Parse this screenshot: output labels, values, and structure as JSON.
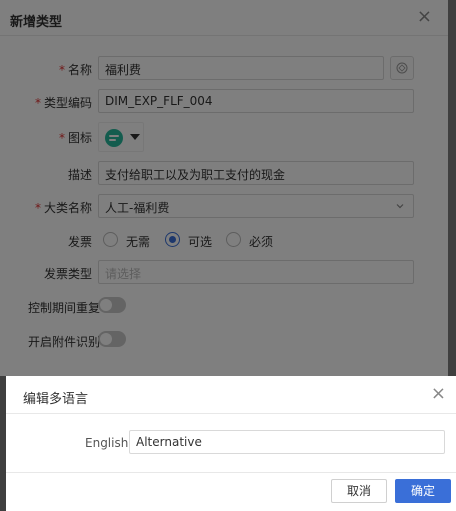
{
  "main_dialog": {
    "title": "新增类型",
    "close_glyph": "×",
    "fields": {
      "name": {
        "label": "名称",
        "value": "福利费"
      },
      "code": {
        "label": "类型编码",
        "value": "DIM_EXP_FLF_004"
      },
      "icon": {
        "label": "图标",
        "icon": "chat-bubble-icon"
      },
      "desc": {
        "label": "描述",
        "value": "支付给职工以及为职工支付的现金"
      },
      "category": {
        "label": "大类名称",
        "value": "人工-福利费"
      },
      "invoice": {
        "label": "发票",
        "options": [
          "无需",
          "可选",
          "必须"
        ],
        "selected": "可选"
      },
      "invoice_type": {
        "label": "发票类型",
        "placeholder": "请选择"
      },
      "dup_check": {
        "label": "控制期间重复",
        "on": false
      },
      "attach_ocr": {
        "label": "开启附件识别",
        "on": false
      }
    },
    "required_mark": "*"
  },
  "lang_dialog": {
    "title": "编辑多语言",
    "close_glyph": "×",
    "field_label": "English",
    "field_value": "Alternative",
    "cancel_label": "取消",
    "ok_label": "确定"
  },
  "colors": {
    "primary": "#3a6fd8",
    "required": "#e03030",
    "icon_badge": "#27b89c",
    "overlay": "rgba(0,0,0,0.5)"
  }
}
